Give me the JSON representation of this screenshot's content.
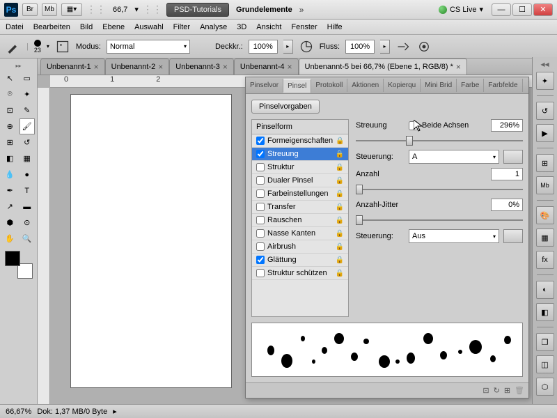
{
  "titlebar": {
    "zoom": "66,7",
    "psd_tutorials": "PSD-Tutorials",
    "doc_name": "Grundelemente",
    "cslive": "CS Live"
  },
  "menu": {
    "items": [
      "Datei",
      "Bearbeiten",
      "Bild",
      "Ebene",
      "Auswahl",
      "Filter",
      "Analyse",
      "3D",
      "Ansicht",
      "Fenster",
      "Hilfe"
    ]
  },
  "optbar": {
    "brush_size": "23",
    "modus_label": "Modus:",
    "modus_value": "Normal",
    "deckkr_label": "Deckkr.:",
    "deckkr_value": "100%",
    "fluss_label": "Fluss:",
    "fluss_value": "100%"
  },
  "doctabs": [
    {
      "label": "Unbenannt-1",
      "active": false
    },
    {
      "label": "Unbenannt-2",
      "active": false
    },
    {
      "label": "Unbenannt-3",
      "active": false
    },
    {
      "label": "Unbenannt-4",
      "active": false
    },
    {
      "label": "Unbenannt-5 bei 66,7% (Ebene 1, RGB/8) *",
      "active": true
    }
  ],
  "panel": {
    "tabs": [
      "Pinselvor",
      "Pinsel",
      "Protokoll",
      "Aktionen",
      "Kopierqu",
      "Mini Brid",
      "Farbe",
      "Farbfelde"
    ],
    "active_tab": "Pinsel",
    "preset_btn": "Pinselvorgaben",
    "list_header": "Pinselform",
    "list": [
      {
        "label": "Formeigenschaften",
        "checked": true,
        "lock": true
      },
      {
        "label": "Streuung",
        "checked": true,
        "lock": true,
        "selected": true
      },
      {
        "label": "Struktur",
        "checked": false,
        "lock": true
      },
      {
        "label": "Dualer Pinsel",
        "checked": false,
        "lock": true
      },
      {
        "label": "Farbeinstellungen",
        "checked": false,
        "lock": true
      },
      {
        "label": "Transfer",
        "checked": false,
        "lock": true
      },
      {
        "label": "Rauschen",
        "checked": false,
        "lock": true
      },
      {
        "label": "Nasse Kanten",
        "checked": false,
        "lock": true
      },
      {
        "label": "Airbrush",
        "checked": false,
        "lock": true
      },
      {
        "label": "Glättung",
        "checked": true,
        "lock": true
      },
      {
        "label": "Struktur schützen",
        "checked": false,
        "lock": true
      }
    ],
    "settings": {
      "streuung_label": "Streuung",
      "beide_achsen": "Beide Achsen",
      "streuung_value": "296%",
      "steuerung_label": "Steuerung:",
      "steuerung1_value": "A",
      "anzahl_label": "Anzahl",
      "anzahl_value": "1",
      "anzahl_jitter_label": "Anzahl-Jitter",
      "anzahl_jitter_value": "0%",
      "steuerung2_value": "Aus"
    }
  },
  "statusbar": {
    "zoom": "66,67%",
    "doc_info": "Dok: 1,37 MB/0 Byte"
  }
}
